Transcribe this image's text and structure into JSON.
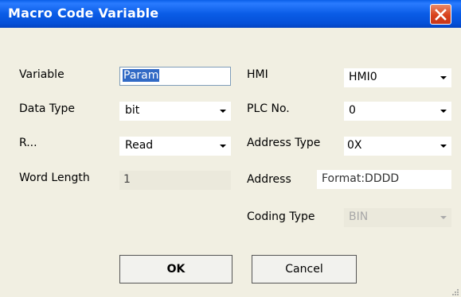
{
  "window": {
    "title": "Macro Code Variable"
  },
  "left": {
    "variable": {
      "label": "Variable",
      "value": "Param"
    },
    "data_type": {
      "label": "Data Type",
      "value": "bit"
    },
    "rw": {
      "label": "R...",
      "value": "Read"
    },
    "word_length": {
      "label": "Word Length",
      "value": "1"
    }
  },
  "right": {
    "hmi": {
      "label": "HMI",
      "value": "HMI0"
    },
    "plc_no": {
      "label": "PLC No.",
      "value": "0"
    },
    "address_type": {
      "label": "Address Type",
      "value": "0X"
    },
    "address": {
      "label": "Address",
      "format": "Format:DDDD"
    },
    "coding_type": {
      "label": "Coding Type",
      "value": "BIN"
    }
  },
  "buttons": {
    "ok": "OK",
    "cancel": "Cancel"
  },
  "colors": {
    "titlebar": "#0a5ce6",
    "dialog_bg": "#f1efe2",
    "selection": "#316ac5",
    "close": "#d8421c"
  }
}
